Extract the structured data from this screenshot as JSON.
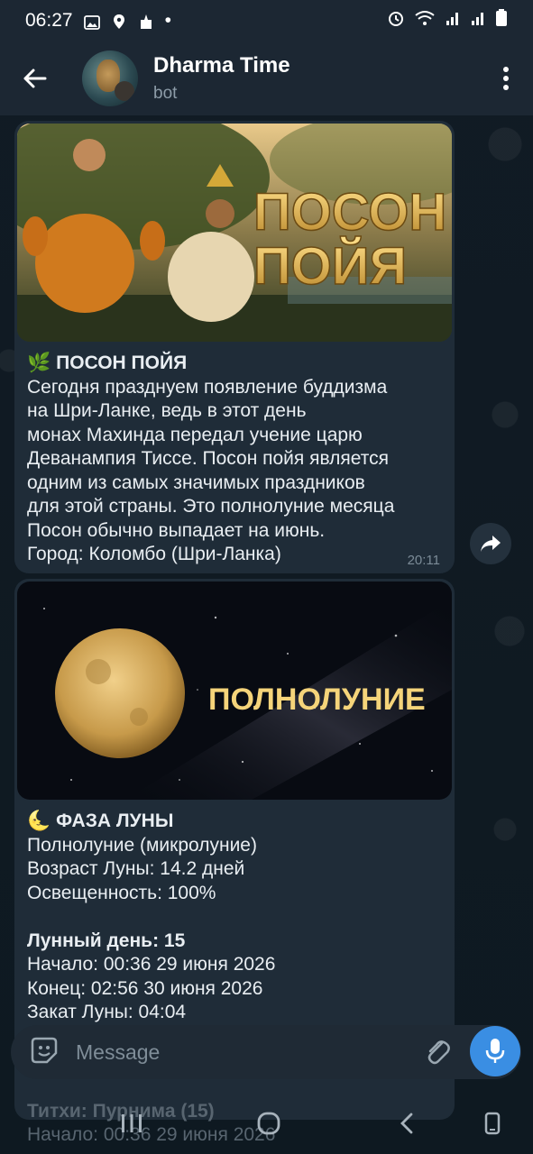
{
  "status_bar": {
    "time": "06:27",
    "dot": "•"
  },
  "header": {
    "title": "Dharma Time",
    "subtitle": "bot"
  },
  "messages": [
    {
      "image_text": [
        "ПОСОН",
        "ПОЙЯ"
      ],
      "emoji": "🌿",
      "heading": "ПОСОН ПОЙЯ",
      "lines": [
        "Сегодня празднуем появление буддизма",
        "на Шри-Ланке, ведь в этот день",
        "монах Махинда передал учение царю",
        "Деванампия Тиссе. Посон пойя является",
        "одним из самых значимых праздников",
        "для этой страны. Это полнолуние месяца",
        "Посон обычно выпадает на июнь.",
        "Город: Коломбо (Шри-Ланка)"
      ],
      "time": "20:11"
    },
    {
      "image_text": "ПОЛНОЛУНИЕ",
      "emoji": "🌜",
      "heading": "ФАЗА ЛУНЫ",
      "lines": [
        "Полнолуние (микролуние)",
        "Возраст Луны: 14.2 дней",
        "Освещенность: 100%"
      ],
      "lunar_heading": "Лунный день: 15",
      "lunar_lines": [
        "Начало: 00:36 29 июня 2026",
        "Конец: 02:56 30 июня 2026",
        "Закат Луны: 04:04"
      ]
    }
  ],
  "faded_lines": [
    "Титхи: Пурнима (15)",
    "Начало: 00:36 29 июня 2026"
  ],
  "input": {
    "placeholder": "Message"
  },
  "icons": {
    "back": "arrow-left-icon",
    "menu": "more-vertical-icon",
    "share": "share-icon",
    "emoji": "sticker-icon",
    "attach": "paperclip-icon",
    "mic": "microphone-icon"
  },
  "colors": {
    "accent": "#3a8ee3",
    "bubble": "#1f2c38",
    "header": "#1c2733"
  }
}
